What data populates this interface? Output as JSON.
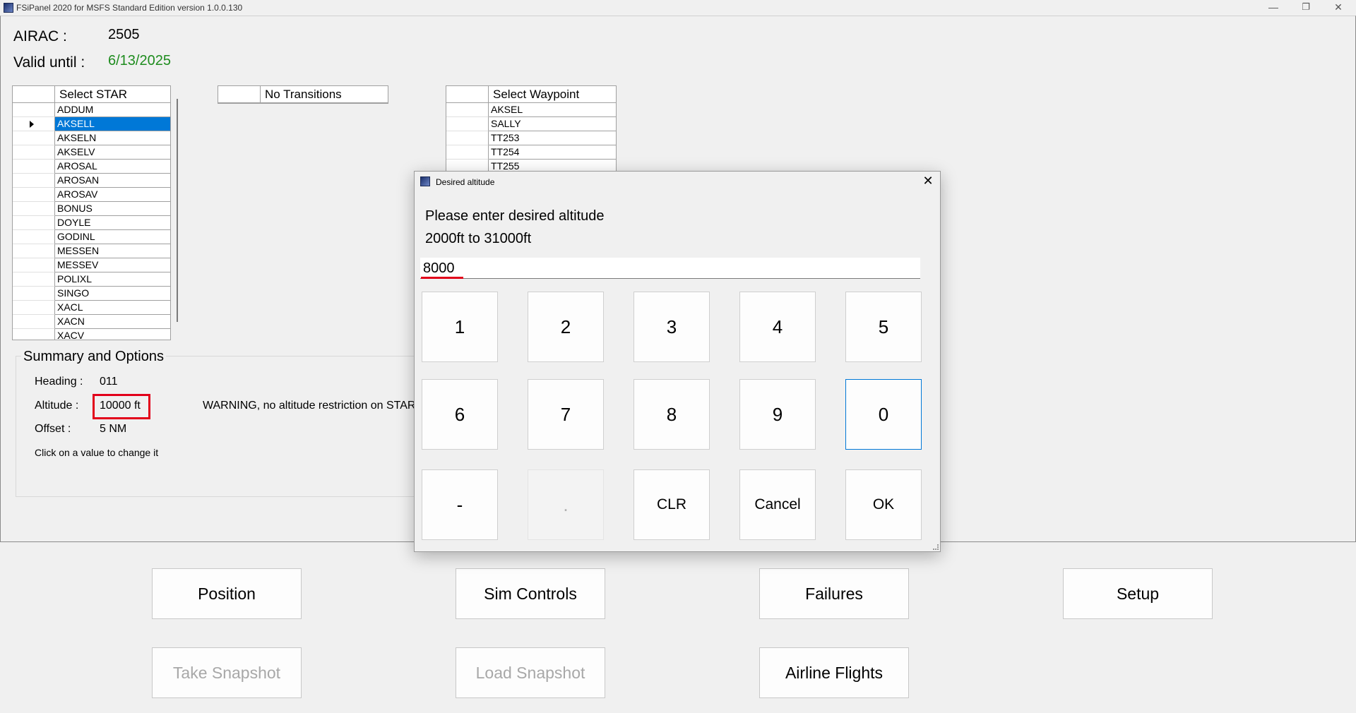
{
  "window": {
    "title": "FSiPanel 2020 for MSFS Standard Edition version 1.0.0.130",
    "controls": {
      "minimize": "—",
      "restore": "❐",
      "close": "✕"
    }
  },
  "airac": {
    "label": "AIRAC :",
    "value": "2505",
    "valid_label": "Valid until :",
    "valid_value": "6/13/2025",
    "valid_color": "#1e8c1e"
  },
  "star_grid": {
    "header": "Select STAR",
    "selected": "AKSELL",
    "items": [
      "ADDUM",
      "AKSELL",
      "AKSELN",
      "AKSELV",
      "AROSAL",
      "AROSAN",
      "AROSAV",
      "BONUS",
      "DOYLE",
      "GODINL",
      "MESSEN",
      "MESSEV",
      "POLIXL",
      "SINGO",
      "XACL",
      "XACN",
      "XACV"
    ]
  },
  "transitions_grid": {
    "header": "No Transitions"
  },
  "waypoint_grid": {
    "header": "Select Waypoint",
    "items": [
      "AKSEL",
      "SALLY",
      "TT253",
      "TT254",
      "TT255"
    ]
  },
  "summary": {
    "title": "Summary and Options",
    "heading_label": "Heading :",
    "heading_value": "011",
    "altitude_label": "Altitude :",
    "altitude_value": "10000 ft",
    "offset_label": "Offset  :",
    "offset_value": "5 NM",
    "hint": "Click on a value to change it",
    "warning": "WARNING, no altitude restriction on STAR"
  },
  "bottom_buttons": {
    "position": "Position",
    "sim_controls": "Sim Controls",
    "failures": "Failures",
    "setup": "Setup",
    "take_snapshot": "Take Snapshot",
    "load_snapshot": "Load Snapshot",
    "airline_flights": "Airline Flights"
  },
  "dialog": {
    "title": "Desired altitude",
    "close": "✕",
    "prompt": "Please enter desired altitude",
    "range": "2000ft to 31000ft",
    "input_value": "8000",
    "keys": {
      "k1": "1",
      "k2": "2",
      "k3": "3",
      "k4": "4",
      "k5": "5",
      "k6": "6",
      "k7": "7",
      "k8": "8",
      "k9": "9",
      "k0": "0",
      "minus": "-",
      "dot": ".",
      "clr": "CLR",
      "cancel": "Cancel",
      "ok": "OK"
    }
  },
  "colors": {
    "selection": "#0078d7",
    "annotation_red": "#e2001a"
  }
}
